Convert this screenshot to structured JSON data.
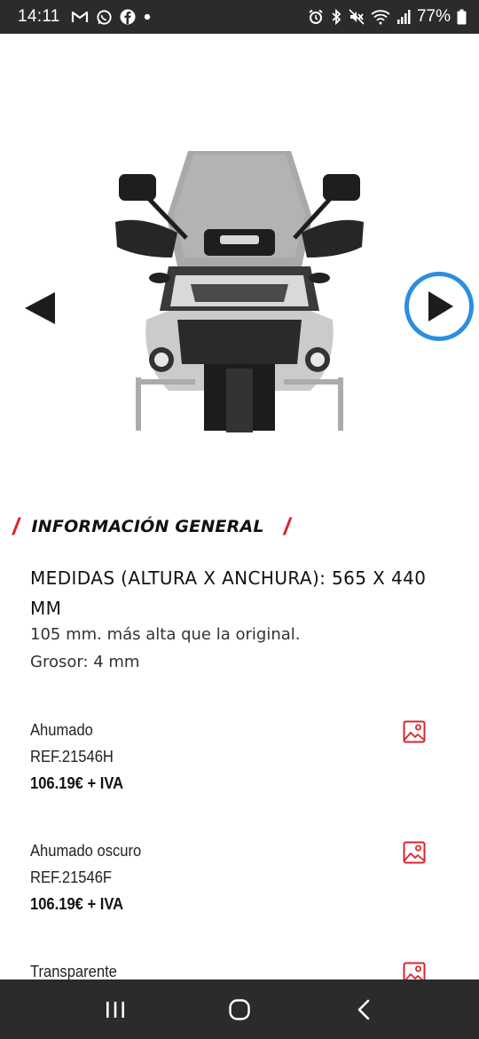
{
  "status_bar": {
    "time": "14:11",
    "battery": "77%",
    "icons_left": [
      "gmail-icon",
      "whatsapp-icon",
      "facebook-icon",
      "dot-icon"
    ],
    "icons_right": [
      "alarm-icon",
      "bluetooth-icon",
      "mute-icon",
      "wifi-icon",
      "signal-icon",
      "battery-icon"
    ]
  },
  "carousel": {
    "image_icon": "motorcycle-windscreen-image",
    "prev_icon": "prev-arrow-icon",
    "next_icon": "next-arrow-icon",
    "accent_color": "#2b8fe0"
  },
  "section": {
    "title": "INFORMACIÓN GENERAL",
    "slash": "/",
    "accent_color": "#d8262f"
  },
  "specs": {
    "title": "MEDIDAS (ALTURA X ANCHURA): 565 X 440 MM",
    "line1": "105 mm. más alta que la original.",
    "line2": "Grosor: 4 mm"
  },
  "variants": [
    {
      "name": "Ahumado",
      "ref": "REF.21546H",
      "price": "106.19€ + IVA"
    },
    {
      "name": "Ahumado oscuro",
      "ref": "REF.21546F",
      "price": "106.19€ + IVA"
    },
    {
      "name": "Transparente",
      "ref": "",
      "price": ""
    }
  ],
  "nav_bar": {
    "icons": [
      "recent-apps-icon",
      "home-icon",
      "back-icon"
    ]
  }
}
